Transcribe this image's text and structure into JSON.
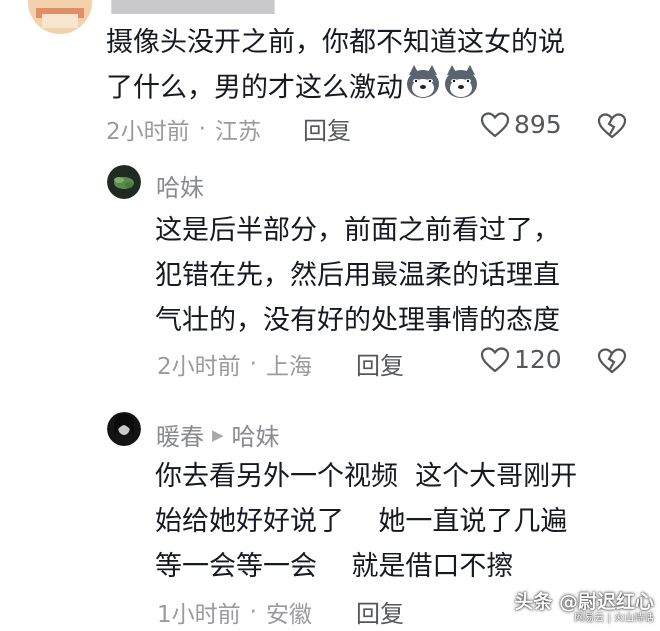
{
  "comments": [
    {
      "username": "",
      "lines": [
        "摄像头没开之前，你都不知道这女的说",
        "了什么，男的才这么激动"
      ],
      "emoji": "husky-face",
      "time": "2小时前",
      "location": "江苏",
      "reply_label": "回复",
      "likes": "895"
    },
    {
      "username": "哈妹",
      "lines": [
        "这是后半部分，前面之前看过了，",
        "犯错在先，然后用最温柔的话理直",
        "气壮的，没有好的处理事情的态度"
      ],
      "time": "2小时前",
      "location": "上海",
      "reply_label": "回复",
      "likes": "120"
    },
    {
      "username": "暖春",
      "reply_to": "哈妹",
      "lines": [
        "你去看另外一个视频  这个大哥刚开",
        "始给她好好说了    她一直说了几遍",
        "等一会等一会    就是借口不擦"
      ],
      "time": "1小时前",
      "location": "安徽",
      "reply_label": "回复"
    }
  ],
  "watermark": {
    "main": "头条 @尉迟红心",
    "sub": "网易云 | 火山诗话"
  },
  "colors": {
    "text": "#161823",
    "meta": "#9a9ba0",
    "action": "#55575d",
    "background": "#ffffff"
  }
}
